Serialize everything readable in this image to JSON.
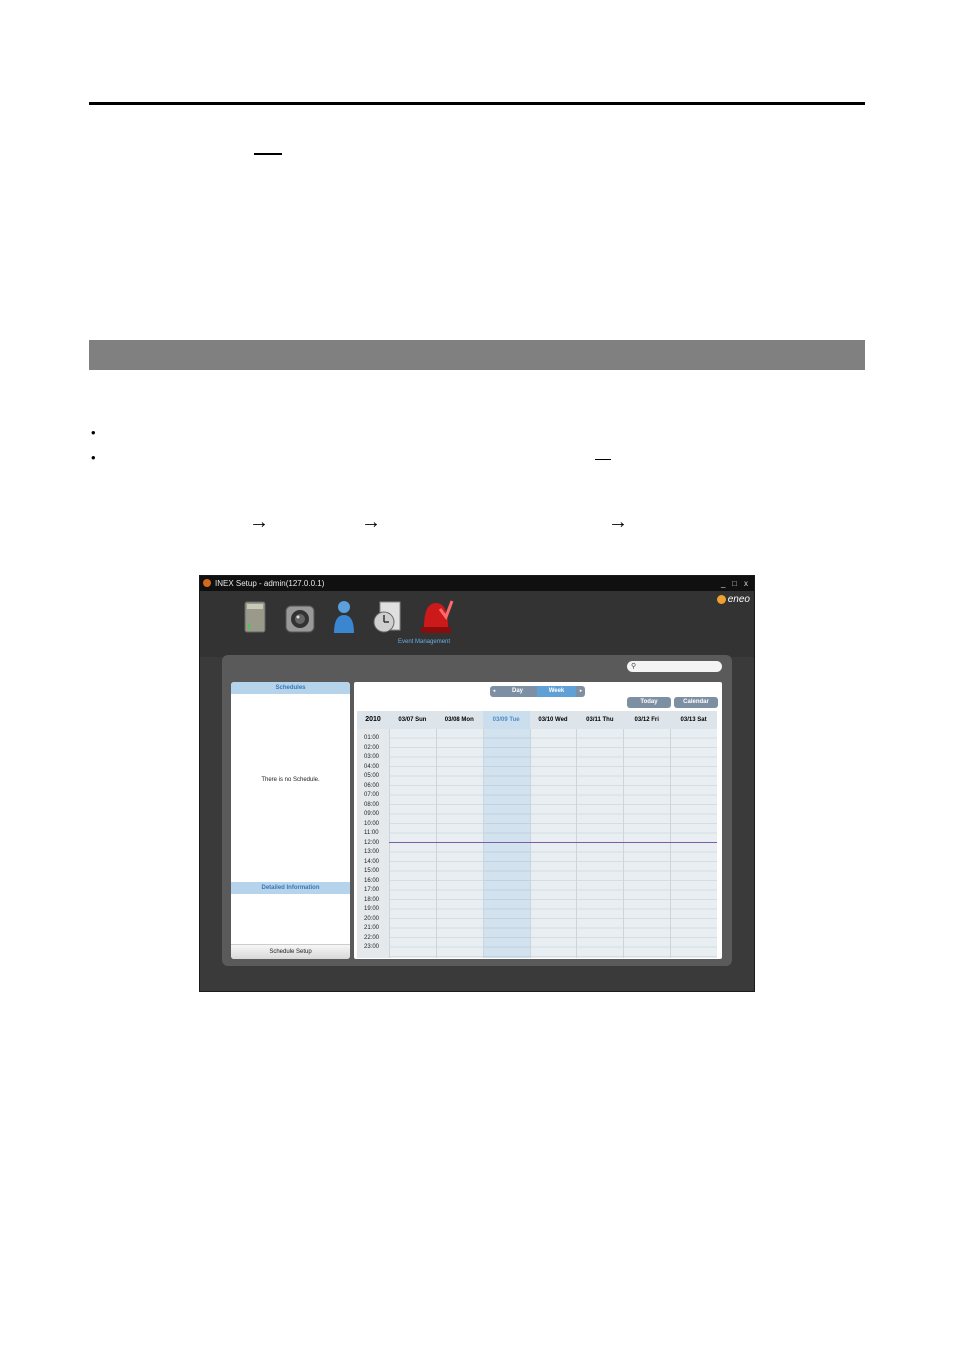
{
  "window": {
    "title": "INEX Setup - admin(127.0.0.1)",
    "controls": [
      "_",
      "□",
      "x"
    ],
    "brand": "eneo"
  },
  "toolbar": {
    "items": [
      {
        "icon": "server-icon"
      },
      {
        "icon": "camera-icon"
      },
      {
        "icon": "user-icon"
      },
      {
        "icon": "schedule-document-icon"
      },
      {
        "icon": "event-alarm-icon",
        "label": "Event Management"
      }
    ]
  },
  "left_panel": {
    "schedules_header": "Schedules",
    "empty_message": "There is no Schedule.",
    "detail_header": "Detailed Information",
    "setup_button": "Schedule Setup"
  },
  "view": {
    "day_label": "Day",
    "week_label": "Week",
    "today_label": "Today",
    "calendar_label": "Calendar"
  },
  "calendar": {
    "year": "2010",
    "days": [
      "03/07 Sun",
      "03/08 Mon",
      "03/09 Tue",
      "03/10 Wed",
      "03/11 Thu",
      "03/12 Fri",
      "03/13 Sat"
    ],
    "today_day": "03/09 Tue",
    "hours": [
      "01:00",
      "02:00",
      "03:00",
      "04:00",
      "05:00",
      "06:00",
      "07:00",
      "08:00",
      "09:00",
      "10:00",
      "11:00",
      "12:00",
      "13:00",
      "14:00",
      "15:00",
      "16:00",
      "17:00",
      "18:00",
      "19:00",
      "20:00",
      "21:00",
      "22:00",
      "23:00"
    ]
  },
  "colors": {
    "accent": "#5fa0d6",
    "header_bar": "#b5d3ea",
    "now_line": "#7b5ca8",
    "section_bar": "#808080"
  }
}
